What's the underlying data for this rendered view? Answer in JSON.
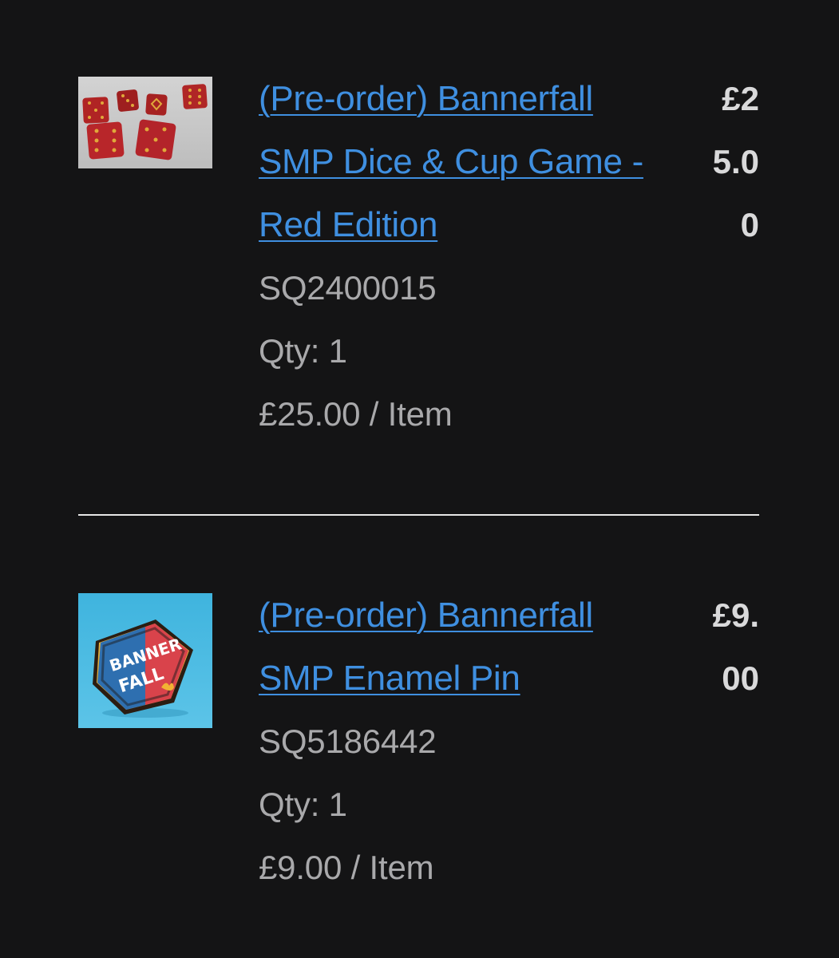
{
  "items": [
    {
      "title": "(Pre-order) Bannerfall SMP Dice & Cup Game - Red Edition",
      "sku": "SQ2400015",
      "qty": "Qty: 1",
      "unit_price": "£25.00 / Item",
      "line_total": "£25.00",
      "thumbnail": "red-dice-image"
    },
    {
      "title": "(Pre-order) Bannerfall SMP Enamel Pin",
      "sku": "SQ5186442",
      "qty": "Qty: 1",
      "unit_price": "£9.00 / Item",
      "line_total": "£9.00",
      "thumbnail": "bannerfall-shield-pin-image",
      "pin_lettering": "BANNER FALL"
    }
  ],
  "colors": {
    "background": "#141415",
    "link": "#3f8fe0",
    "meta_text": "#a9a9ab",
    "total_text": "#d9d9da",
    "divider": "#e6e6e6"
  }
}
